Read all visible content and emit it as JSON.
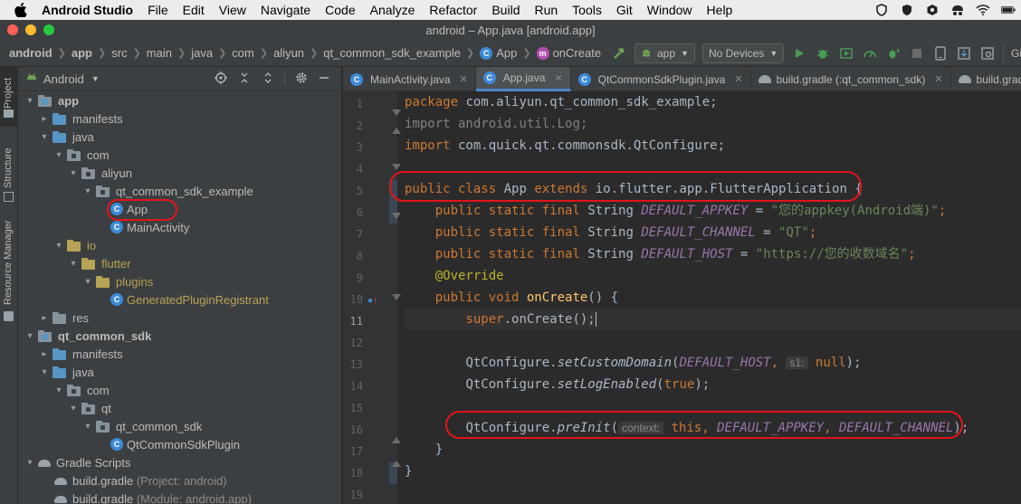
{
  "menubar": {
    "app_name": "Android Studio",
    "items": [
      "File",
      "Edit",
      "View",
      "Navigate",
      "Code",
      "Analyze",
      "Refactor",
      "Build",
      "Run",
      "Tools",
      "Git",
      "Window",
      "Help"
    ]
  },
  "window": {
    "title": "android – App.java [android.app]"
  },
  "breadcrumb": {
    "project": "android",
    "items": [
      "app",
      "src",
      "main",
      "java",
      "com",
      "aliyun",
      "qt_common_sdk_example"
    ],
    "class": "App",
    "method": "onCreate"
  },
  "toolbar": {
    "run_config": "app",
    "device": "No Devices",
    "git_label": "Git:"
  },
  "side_tabs": {
    "project": "Project",
    "structure": "Structure",
    "resource_manager": "Resource Manager"
  },
  "project_panel": {
    "view_mode": "Android",
    "tree": [
      {
        "label": "app",
        "depth": 0,
        "expanded": true,
        "icon": "module-folder",
        "bold": true
      },
      {
        "label": "manifests",
        "depth": 1,
        "expanded": false,
        "icon": "folder"
      },
      {
        "label": "java",
        "depth": 1,
        "expanded": true,
        "icon": "folder-blue"
      },
      {
        "label": "com",
        "depth": 2,
        "expanded": true,
        "icon": "package"
      },
      {
        "label": "aliyun",
        "depth": 3,
        "expanded": true,
        "icon": "package"
      },
      {
        "label": "qt_common_sdk_example",
        "depth": 4,
        "expanded": true,
        "icon": "package"
      },
      {
        "label": "App",
        "depth": 5,
        "icon": "class",
        "highlight": true
      },
      {
        "label": "MainActivity",
        "depth": 5,
        "icon": "class"
      },
      {
        "label": "io",
        "depth": 2,
        "expanded": true,
        "icon": "package-gold",
        "gold": true
      },
      {
        "label": "flutter",
        "depth": 3,
        "expanded": true,
        "icon": "package-gold",
        "gold": true
      },
      {
        "label": "plugins",
        "depth": 4,
        "expanded": true,
        "icon": "package-gold",
        "gold": true
      },
      {
        "label": "GeneratedPluginRegistrant",
        "depth": 5,
        "icon": "class",
        "gold": true
      },
      {
        "label": "res",
        "depth": 1,
        "expanded": false,
        "icon": "folder"
      },
      {
        "label": "qt_common_sdk",
        "depth": 0,
        "expanded": true,
        "icon": "module-folder",
        "bold": true
      },
      {
        "label": "manifests",
        "depth": 1,
        "expanded": false,
        "icon": "folder"
      },
      {
        "label": "java",
        "depth": 1,
        "expanded": true,
        "icon": "folder-blue"
      },
      {
        "label": "com",
        "depth": 2,
        "expanded": true,
        "icon": "package"
      },
      {
        "label": "qt",
        "depth": 3,
        "expanded": true,
        "icon": "package"
      },
      {
        "label": "qt_common_sdk",
        "depth": 4,
        "expanded": true,
        "icon": "package"
      },
      {
        "label": "QtCommonSdkPlugin",
        "depth": 5,
        "icon": "class"
      },
      {
        "label": "Gradle Scripts",
        "depth": 0,
        "expanded": true,
        "icon": "gradle"
      },
      {
        "label": "build.gradle",
        "depth": 1,
        "icon": "gradle",
        "suffix": "(Project: android)"
      },
      {
        "label": "build.gradle",
        "depth": 1,
        "icon": "gradle",
        "suffix": "(Module: android.app)"
      }
    ]
  },
  "editor_tabs": [
    {
      "label": "MainActivity.java",
      "icon": "class"
    },
    {
      "label": "App.java",
      "icon": "class",
      "active": true
    },
    {
      "label": "QtCommonSdkPlugin.java",
      "icon": "class"
    },
    {
      "label": "build.gradle (:qt_common_sdk)",
      "icon": "gradle"
    },
    {
      "label": "build.gradle (:app)",
      "icon": "gradle"
    }
  ],
  "code": {
    "line_numbers": [
      "1",
      "2",
      "3",
      "4",
      "5",
      "6",
      "7",
      "8",
      "9",
      "10",
      "11",
      "12",
      "13",
      "14",
      "15",
      "16",
      "17",
      "18",
      "19"
    ],
    "current_line": 11,
    "lines": {
      "l1_kw": "package",
      "l1_rest": " com.aliyun.qt_common_sdk_example;",
      "l2_kw": "import",
      "l2_rest": " android.util.Log;",
      "l3_kw": "import",
      "l3_rest": " com.quick.qt.commonsdk.QtConfigure;",
      "l5_kw": "public class",
      "l5_name": " App ",
      "l5_ext": "extends",
      "l5_rest": " io.flutter.app.FlutterApplication {",
      "l6_kw": "public static final",
      "l6_type": " String ",
      "l6_field": "DEFAULT_APPKEY",
      "l6_eq": " = ",
      "l6_str": "\"您的appkey(Android端)\"",
      "l6_end": ";",
      "l7_kw": "public static final",
      "l7_type": " String ",
      "l7_field": "DEFAULT_CHANNEL",
      "l7_eq": " = ",
      "l7_str": "\"QT\"",
      "l7_end": ";",
      "l8_kw": "public static final",
      "l8_type": " String ",
      "l8_field": "DEFAULT_HOST",
      "l8_eq": " = ",
      "l8_str": "\"https://您的收数域名\"",
      "l8_end": ";",
      "l9_ann": "@Override",
      "l10_kw": "public void",
      "l10_fn": " onCreate",
      "l10_rest": "() {",
      "l11_kw": "super",
      "l11_rest": ".onCreate();",
      "l13_obj": "QtConfigure.",
      "l13_fn": "setCustomDomain",
      "l13_p1": "(",
      "l13_field": "DEFAULT_HOST",
      "l13_sep": ", ",
      "l13_hint": "s1:",
      "l13_kw": " null",
      "l13_end": ");",
      "l14_obj": "QtConfigure.",
      "l14_fn": "setLogEnabled",
      "l14_p1": "(",
      "l14_kw": "true",
      "l14_end": ");",
      "l16_obj": "QtConfigure.",
      "l16_fn": "preInit",
      "l16_p1": "(",
      "l16_hint": "context:",
      "l16_kw": " this",
      "l16_sep": ", ",
      "l16_f1": "DEFAULT_APPKEY",
      "l16_sep2": ", ",
      "l16_f2": "DEFAULT_CHANNEL",
      "l16_end": ");",
      "l17": "}",
      "l18": "}"
    }
  },
  "colors": {
    "annotation_oval": "#e3131a",
    "keyword": "#cc7832",
    "string": "#6a8759",
    "field": "#9876aa",
    "function": "#ffc66d",
    "annotation": "#bbb529"
  }
}
